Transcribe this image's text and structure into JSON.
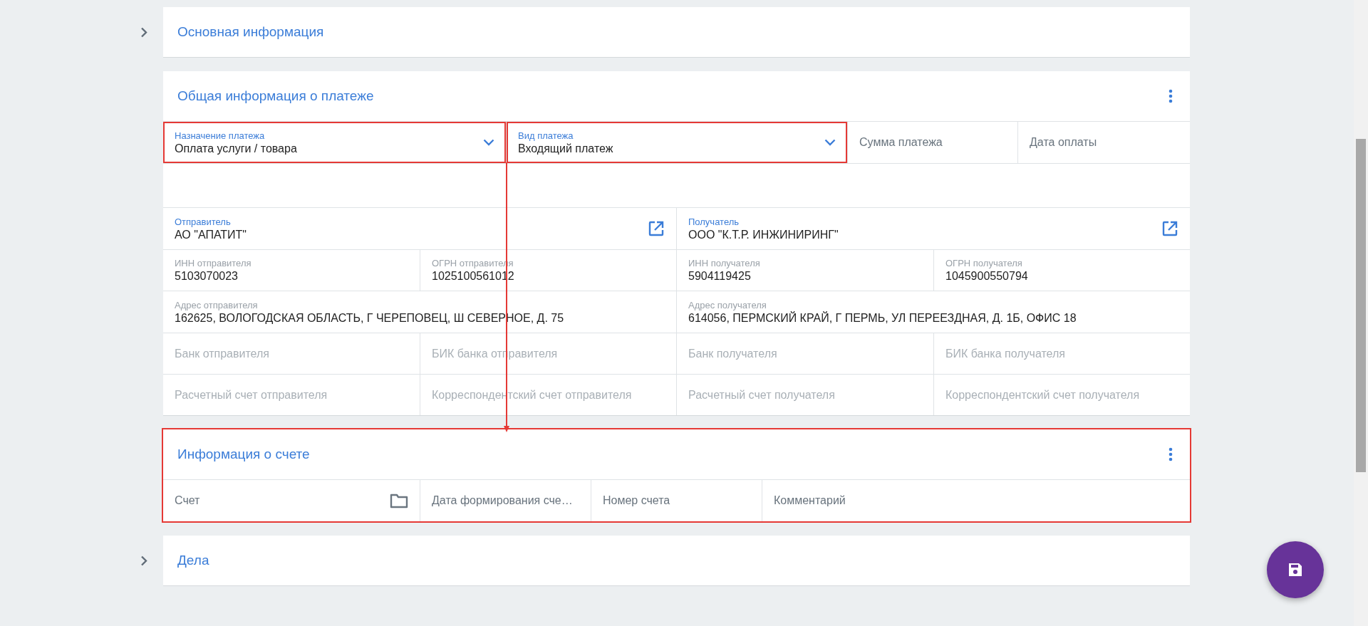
{
  "sections": [
    {
      "title": "Основная информация",
      "expanded": false,
      "highlighted": false,
      "menu": false
    },
    {
      "title": "Общая информация о платеже",
      "expanded": true,
      "highlighted": false,
      "menu": true,
      "rows": [
        {
          "kind": "payment",
          "fields": [
            {
              "kind": "select",
              "label": "Назначение платежа",
              "value": "Оплата услуги / товара",
              "highlighted": true
            },
            {
              "kind": "select",
              "label": "Вид платежа",
              "value": "Входящий платеж",
              "highlighted": true
            },
            {
              "kind": "empty",
              "label": "Сумма платежа",
              "disabled": false,
              "highlighted": false
            },
            {
              "kind": "empty",
              "label": "Дата оплаты",
              "disabled": false,
              "highlighted": false
            }
          ]
        },
        {
          "kind": "halves",
          "fields": [
            {
              "kind": "party",
              "label": "Отправитель",
              "value": "АО \"АПАТИТ\"",
              "highlighted": false
            },
            {
              "kind": "party",
              "label": "Получатель",
              "value": "ООО \"К.Т.Р. ИНЖИНИРИНГ\"",
              "highlighted": false
            }
          ]
        },
        {
          "kind": "quarters",
          "fields": [
            {
              "kind": "readonly",
              "label": "ИНН отправителя",
              "value": "5103070023",
              "highlighted": false
            },
            {
              "kind": "readonly",
              "label": "ОГРН отправителя",
              "value": "1025100561012",
              "highlighted": false
            },
            {
              "kind": "readonly",
              "label": "ИНН получателя",
              "value": "5904119425",
              "highlighted": false
            },
            {
              "kind": "readonly",
              "label": "ОГРН получателя",
              "value": "1045900550794",
              "highlighted": false
            }
          ]
        },
        {
          "kind": "halves",
          "fields": [
            {
              "kind": "readonly",
              "label": "Адрес отправителя",
              "value": "162625, ВОЛОГОДСКАЯ ОБЛАСТЬ, Г ЧЕРЕПОВЕЦ, Ш СЕВЕРНОЕ, Д. 75",
              "highlighted": false
            },
            {
              "kind": "readonly",
              "label": "Адрес получателя",
              "value": "614056, ПЕРМСКИЙ КРАЙ, Г ПЕРМЬ, УЛ ПЕРЕЕЗДНАЯ, Д. 1Б, ОФИС 18",
              "highlighted": false
            }
          ]
        },
        {
          "kind": "quarters",
          "fields": [
            {
              "kind": "empty",
              "label": "Банк отправителя",
              "disabled": true,
              "highlighted": false
            },
            {
              "kind": "empty",
              "label": "БИК банка отправителя",
              "disabled": true,
              "highlighted": false
            },
            {
              "kind": "empty",
              "label": "Банк получателя",
              "disabled": true,
              "highlighted": false
            },
            {
              "kind": "empty",
              "label": "БИК банка получателя",
              "disabled": true,
              "highlighted": false
            }
          ]
        },
        {
          "kind": "quarters",
          "fields": [
            {
              "kind": "empty",
              "label": "Расчетный счет отправителя",
              "disabled": true,
              "highlighted": false
            },
            {
              "kind": "empty",
              "label": "Корреспондентский счет отправителя",
              "disabled": true,
              "highlighted": false
            },
            {
              "kind": "empty",
              "label": "Расчетный счет получателя",
              "disabled": true,
              "highlighted": false
            },
            {
              "kind": "empty",
              "label": "Корреспондентский счет получателя",
              "disabled": true,
              "highlighted": false
            }
          ]
        }
      ]
    },
    {
      "title": "Информация о счете",
      "expanded": true,
      "highlighted": true,
      "menu": true,
      "rows": [
        {
          "kind": "invoice",
          "fields": [
            {
              "kind": "picker",
              "label": "Счет",
              "highlighted": false
            },
            {
              "kind": "empty",
              "label": "Дата формирования сче…",
              "disabled": false,
              "highlighted": false
            },
            {
              "kind": "empty",
              "label": "Номер счета",
              "disabled": false,
              "highlighted": false
            },
            {
              "kind": "empty",
              "label": "Комментарий",
              "disabled": false,
              "highlighted": false
            }
          ]
        }
      ]
    },
    {
      "title": "Дела",
      "expanded": false,
      "highlighted": false,
      "menu": false
    }
  ],
  "save_button": {
    "visible": true
  }
}
